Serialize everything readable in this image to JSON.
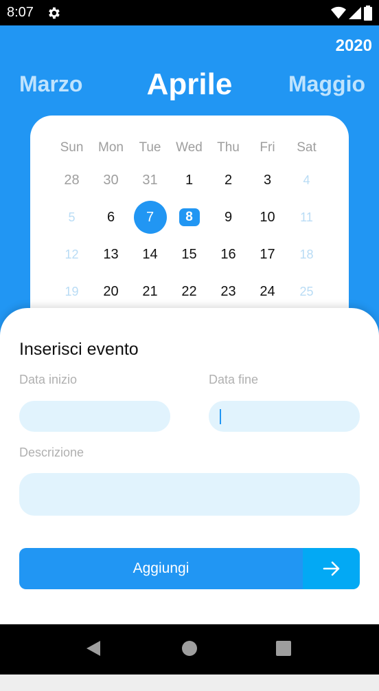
{
  "status_bar": {
    "time": "8:07",
    "icons": [
      "gear-icon",
      "wifi-icon",
      "signal-icon",
      "battery-icon"
    ]
  },
  "header": {
    "year": "2020",
    "prev_month": "Marzo",
    "current_month": "Aprile",
    "next_month": "Maggio",
    "background": "#2196f3"
  },
  "calendar": {
    "weekdays": [
      "Sun",
      "Mon",
      "Tue",
      "Wed",
      "Thu",
      "Fri",
      "Sat"
    ],
    "weeks": [
      [
        "28",
        "30",
        "31",
        "1",
        "2",
        "3",
        "4"
      ],
      [
        "5",
        "6",
        "7",
        "8",
        "9",
        "10",
        "11"
      ],
      [
        "12",
        "13",
        "14",
        "15",
        "16",
        "17",
        "18"
      ],
      [
        "19",
        "20",
        "21",
        "22",
        "23",
        "24",
        "25"
      ]
    ],
    "selected_day": "7",
    "today": "8"
  },
  "form": {
    "title": "Inserisci evento",
    "start_label": "Data inizio",
    "end_label": "Data fine",
    "description_label": "Descrizione",
    "start_value": "",
    "end_value": "",
    "description_value": "",
    "submit_label": "Aggiungi"
  },
  "nav_bar": {
    "icons": [
      "back-icon",
      "home-icon",
      "recents-icon"
    ]
  }
}
